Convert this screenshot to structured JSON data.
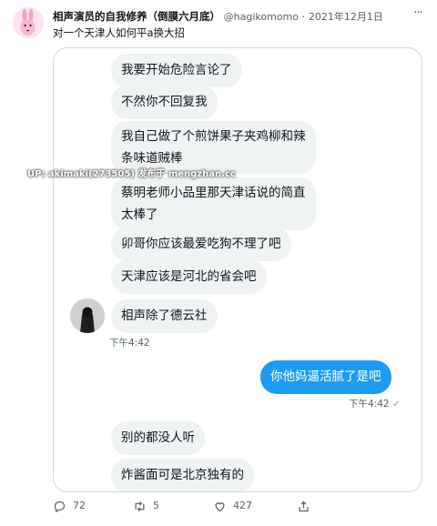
{
  "tweet": {
    "author_name": "相声演员的自我修养（倒膜六月底）",
    "handle": "@hagikomomo",
    "separator": "·",
    "date": "2021年12月1日",
    "text": "对一个天津人如何平a换大招",
    "more_icon": "more-icon"
  },
  "conversation": {
    "received_group_1": [
      "我要开始危险言论了",
      "不然你不回复我",
      "我自己做了个煎饼果子夹鸡柳和辣\n条味道贼棒",
      "蔡明老师小品里那天津话说的简直\n太棒了",
      "卯哥你应该最爱吃狗不理了吧",
      "天津应该是河北的省会吧",
      "相声除了德云社"
    ],
    "received_time_1": "下午4:42",
    "sent_message": "你他妈逼活腻了是吧",
    "sent_time": "下午4:42",
    "sent_status_icon": "read-check-icon",
    "received_group_2": [
      "别的都没人听",
      "炸酱面可是北京独有的"
    ]
  },
  "watermark": "UP: akimaki(273505) 发布于 mengzhan.cc",
  "actions": {
    "reply_count": "72",
    "retweet_count": "5",
    "like_count": "427"
  }
}
